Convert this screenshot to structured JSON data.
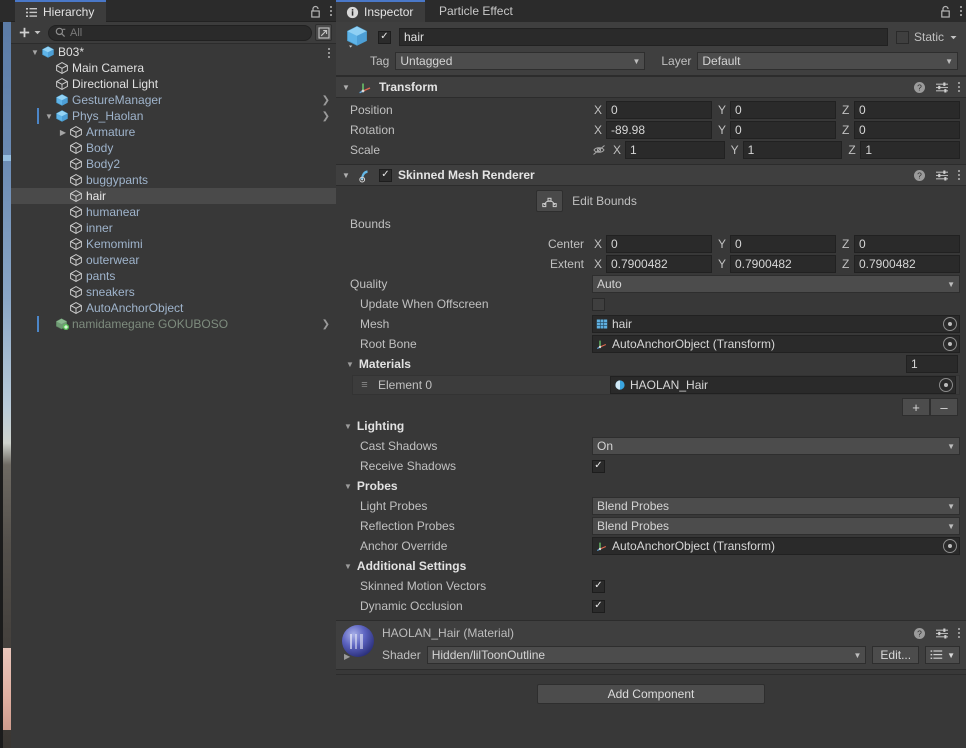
{
  "colors": {
    "accent_blue": "#4a78c8",
    "panel_bg": "#383838",
    "header_bg": "#3f3f3f",
    "tabbar_bg": "#2b2b2b",
    "field_bg": "#2a2a2a",
    "dropdown_bg": "#4c4c4c",
    "hierarchy_link": "#9fb4cc",
    "selected_row": "#4a4a4a",
    "prefab_marker": "#4c86c8"
  },
  "hierarchy": {
    "tab_label": "Hierarchy",
    "tab_icon": "hierarchy-icon",
    "lock_icon": "lock-icon",
    "menu_icon": "kebab-menu-icon",
    "toolbar": {
      "add_label": "+",
      "add_dropdown_icon": "chevron-down-icon",
      "search_placeholder": "All",
      "search_value": "",
      "search_icon": "search-icon",
      "expand_icon": "expand-panel-icon"
    },
    "items": [
      {
        "label": "B03*",
        "depth": 1,
        "foldout": "open",
        "icon": "prefab-cube-icon",
        "style": "white",
        "marker": false,
        "chevron": false,
        "kebab": true
      },
      {
        "label": "Main Camera",
        "depth": 2,
        "foldout": "none",
        "icon": "gameobject-icon",
        "style": "white",
        "marker": false,
        "chevron": false,
        "kebab": false
      },
      {
        "label": "Directional Light",
        "depth": 2,
        "foldout": "none",
        "icon": "gameobject-icon",
        "style": "white",
        "marker": false,
        "chevron": false,
        "kebab": false
      },
      {
        "label": "GestureManager",
        "depth": 2,
        "foldout": "none",
        "icon": "prefab-cube-icon",
        "style": "link",
        "marker": false,
        "chevron": true,
        "kebab": false
      },
      {
        "label": "Phys_Haolan",
        "depth": 2,
        "foldout": "open",
        "icon": "prefab-cube-icon",
        "style": "link",
        "marker": true,
        "chevron": true,
        "kebab": false
      },
      {
        "label": "Armature",
        "depth": 3,
        "foldout": "closed",
        "icon": "gameobject-icon",
        "style": "link",
        "marker": false,
        "chevron": false,
        "kebab": false
      },
      {
        "label": "Body",
        "depth": 3,
        "foldout": "none",
        "icon": "gameobject-icon",
        "style": "link",
        "marker": false,
        "chevron": false,
        "kebab": false
      },
      {
        "label": "Body2",
        "depth": 3,
        "foldout": "none",
        "icon": "gameobject-icon",
        "style": "link",
        "marker": false,
        "chevron": false,
        "kebab": false
      },
      {
        "label": "buggypants",
        "depth": 3,
        "foldout": "none",
        "icon": "gameobject-icon",
        "style": "link",
        "marker": false,
        "chevron": false,
        "kebab": false
      },
      {
        "label": "hair",
        "depth": 3,
        "foldout": "none",
        "icon": "gameobject-icon",
        "style": "selected",
        "marker": false,
        "chevron": false,
        "kebab": false
      },
      {
        "label": "humanear",
        "depth": 3,
        "foldout": "none",
        "icon": "gameobject-icon",
        "style": "link",
        "marker": false,
        "chevron": false,
        "kebab": false
      },
      {
        "label": "inner",
        "depth": 3,
        "foldout": "none",
        "icon": "gameobject-icon",
        "style": "link",
        "marker": false,
        "chevron": false,
        "kebab": false
      },
      {
        "label": "Kemomimi",
        "depth": 3,
        "foldout": "none",
        "icon": "gameobject-icon",
        "style": "link",
        "marker": false,
        "chevron": false,
        "kebab": false
      },
      {
        "label": "outerwear",
        "depth": 3,
        "foldout": "none",
        "icon": "gameobject-icon",
        "style": "link",
        "marker": false,
        "chevron": false,
        "kebab": false
      },
      {
        "label": "pants",
        "depth": 3,
        "foldout": "none",
        "icon": "gameobject-icon",
        "style": "link",
        "marker": false,
        "chevron": false,
        "kebab": false
      },
      {
        "label": "sneakers",
        "depth": 3,
        "foldout": "none",
        "icon": "gameobject-icon",
        "style": "link",
        "marker": false,
        "chevron": false,
        "kebab": false
      },
      {
        "label": "AutoAnchorObject",
        "depth": 3,
        "foldout": "none",
        "icon": "gameobject-icon",
        "style": "link",
        "marker": false,
        "chevron": false,
        "kebab": false
      },
      {
        "label": "namidamegane GOKUBOSO",
        "depth": 2,
        "foldout": "none",
        "icon": "prefab-variant-icon",
        "style": "dim",
        "marker": true,
        "chevron": true,
        "kebab": false
      }
    ]
  },
  "inspector": {
    "tabs": [
      {
        "label": "Inspector",
        "icon": "info-icon",
        "active": true
      },
      {
        "label": "Particle Effect",
        "icon": "",
        "active": false
      }
    ],
    "lock_icon": "lock-icon",
    "menu_icon": "kebab-menu-icon",
    "object_header": {
      "icon": "prefab-cube-icon",
      "enabled_checkbox": true,
      "name_value": "hair",
      "static_label": "Static",
      "static_checked": false,
      "static_dropdown_icon": "chevron-down-icon",
      "tag_label": "Tag",
      "tag_value": "Untagged",
      "layer_label": "Layer",
      "layer_value": "Default"
    },
    "components": [
      {
        "name": "transform-component",
        "title": "Transform",
        "icon": "transform-icon",
        "has_checkbox": false,
        "help_icon": "help-icon",
        "preset_icon": "preset-icon",
        "menu_icon": "kebab-menu-icon",
        "rows": [
          {
            "label": "Position",
            "axes": [
              "X",
              "Y",
              "Z"
            ],
            "values": [
              "0",
              "0",
              "0"
            ]
          },
          {
            "label": "Rotation",
            "axes": [
              "X",
              "Y",
              "Z"
            ],
            "values": [
              "-89.98",
              "0",
              "0"
            ]
          },
          {
            "label": "Scale",
            "axes": [
              "X",
              "Y",
              "Z"
            ],
            "values": [
              "1",
              "1",
              "1"
            ],
            "link_icon": "constrain-proportions-off-icon"
          }
        ]
      },
      {
        "name": "skinned-mesh-renderer-component",
        "title": "Skinned Mesh Renderer",
        "icon": "skinned-mesh-renderer-icon",
        "has_checkbox": true,
        "checked": true,
        "help_icon": "help-icon",
        "preset_icon": "preset-icon",
        "menu_icon": "kebab-menu-icon",
        "edit_bounds": {
          "label": "Edit Bounds",
          "icon": "edit-bounds-icon"
        },
        "bounds_label": "Bounds",
        "bounds_rows": [
          {
            "label": "Center",
            "axes": [
              "X",
              "Y",
              "Z"
            ],
            "values": [
              "0",
              "0",
              "0"
            ]
          },
          {
            "label": "Extent",
            "axes": [
              "X",
              "Y",
              "Z"
            ],
            "values": [
              "0.7900482",
              "0.7900482",
              "0.7900482"
            ]
          }
        ],
        "quality_label": "Quality",
        "quality_value": "Auto",
        "update_offscreen_label": "Update When Offscreen",
        "update_offscreen_checked": false,
        "mesh_label": "Mesh",
        "mesh_value": "hair",
        "mesh_icon": "mesh-icon",
        "root_bone_label": "Root Bone",
        "root_bone_value": "AutoAnchorObject (Transform)",
        "root_bone_icon": "transform-icon",
        "materials_label": "Materials",
        "materials_count": "1",
        "materials": [
          {
            "label": "Element 0",
            "value": "HAOLAN_Hair",
            "icon": "material-icon"
          }
        ],
        "add_label": "+",
        "remove_label": "–",
        "lighting_label": "Lighting",
        "cast_shadows_label": "Cast Shadows",
        "cast_shadows_value": "On",
        "receive_shadows_label": "Receive Shadows",
        "receive_shadows_checked": true,
        "probes_label": "Probes",
        "light_probes_label": "Light Probes",
        "light_probes_value": "Blend Probes",
        "reflection_probes_label": "Reflection Probes",
        "reflection_probes_value": "Blend Probes",
        "anchor_override_label": "Anchor Override",
        "anchor_override_value": "AutoAnchorObject (Transform)",
        "additional_settings_label": "Additional Settings",
        "skinned_motion_vectors_label": "Skinned Motion Vectors",
        "skinned_motion_vectors_checked": true,
        "dynamic_occlusion_label": "Dynamic Occlusion",
        "dynamic_occlusion_checked": true
      }
    ],
    "material_preview": {
      "title": "HAOLAN_Hair (Material)",
      "thumb_icon": "material-sphere-icon",
      "foldout_icon": "chevron-right-icon",
      "shader_label": "Shader",
      "shader_value": "Hidden/lilToonOutline",
      "edit_label": "Edit...",
      "presets_icon": "shader-presets-icon",
      "help_icon": "help-icon",
      "preset_icon": "preset-icon",
      "menu_icon": "kebab-menu-icon"
    },
    "add_component_label": "Add Component"
  }
}
